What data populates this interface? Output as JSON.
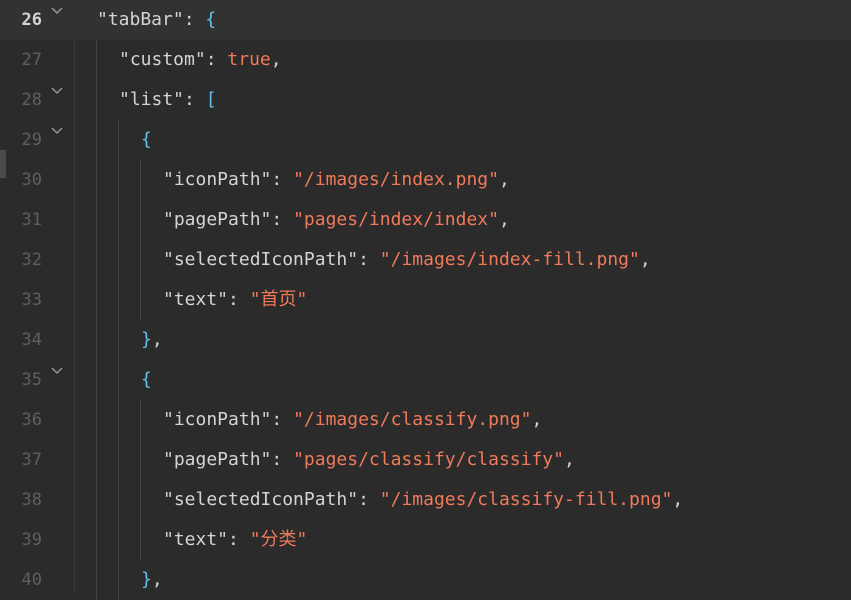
{
  "lines": [
    {
      "num": "26",
      "fold": true,
      "current": true,
      "indent": 1,
      "parts": [
        [
          "k",
          "\"tabBar\""
        ],
        [
          "p",
          ": "
        ],
        [
          "br",
          "{"
        ]
      ]
    },
    {
      "num": "27",
      "fold": false,
      "current": false,
      "indent": 2,
      "parts": [
        [
          "k",
          "\"custom\""
        ],
        [
          "p",
          ": "
        ],
        [
          "b",
          "true"
        ],
        [
          "p",
          ","
        ]
      ]
    },
    {
      "num": "28",
      "fold": true,
      "current": false,
      "indent": 2,
      "parts": [
        [
          "k",
          "\"list\""
        ],
        [
          "p",
          ": "
        ],
        [
          "br",
          "["
        ]
      ]
    },
    {
      "num": "29",
      "fold": true,
      "current": false,
      "indent": 3,
      "parts": [
        [
          "br",
          "{"
        ]
      ]
    },
    {
      "num": "30",
      "fold": false,
      "current": false,
      "indent": 4,
      "parts": [
        [
          "k",
          "\"iconPath\""
        ],
        [
          "p",
          ": "
        ],
        [
          "s",
          "\"/images/index.png\""
        ],
        [
          "p",
          ","
        ]
      ]
    },
    {
      "num": "31",
      "fold": false,
      "current": false,
      "indent": 4,
      "parts": [
        [
          "k",
          "\"pagePath\""
        ],
        [
          "p",
          ": "
        ],
        [
          "s",
          "\"pages/index/index\""
        ],
        [
          "p",
          ","
        ]
      ]
    },
    {
      "num": "32",
      "fold": false,
      "current": false,
      "indent": 4,
      "parts": [
        [
          "k",
          "\"selectedIconPath\""
        ],
        [
          "p",
          ": "
        ],
        [
          "s",
          "\"/images/index-fill.png\""
        ],
        [
          "p",
          ","
        ]
      ]
    },
    {
      "num": "33",
      "fold": false,
      "current": false,
      "indent": 4,
      "parts": [
        [
          "k",
          "\"text\""
        ],
        [
          "p",
          ": "
        ],
        [
          "s",
          "\"首页\""
        ]
      ]
    },
    {
      "num": "34",
      "fold": false,
      "current": false,
      "indent": 3,
      "parts": [
        [
          "br",
          "}"
        ],
        [
          "p",
          ","
        ]
      ]
    },
    {
      "num": "35",
      "fold": true,
      "current": false,
      "indent": 3,
      "parts": [
        [
          "br",
          "{"
        ]
      ]
    },
    {
      "num": "36",
      "fold": false,
      "current": false,
      "indent": 4,
      "parts": [
        [
          "k",
          "\"iconPath\""
        ],
        [
          "p",
          ": "
        ],
        [
          "s",
          "\"/images/classify.png\""
        ],
        [
          "p",
          ","
        ]
      ]
    },
    {
      "num": "37",
      "fold": false,
      "current": false,
      "indent": 4,
      "parts": [
        [
          "k",
          "\"pagePath\""
        ],
        [
          "p",
          ": "
        ],
        [
          "s",
          "\"pages/classify/classify\""
        ],
        [
          "p",
          ","
        ]
      ]
    },
    {
      "num": "38",
      "fold": false,
      "current": false,
      "indent": 4,
      "parts": [
        [
          "k",
          "\"selectedIconPath\""
        ],
        [
          "p",
          ": "
        ],
        [
          "s",
          "\"/images/classify-fill.png\""
        ],
        [
          "p",
          ","
        ]
      ]
    },
    {
      "num": "39",
      "fold": false,
      "current": false,
      "indent": 4,
      "parts": [
        [
          "k",
          "\"text\""
        ],
        [
          "p",
          ": "
        ],
        [
          "s",
          "\"分类\""
        ]
      ]
    },
    {
      "num": "40",
      "fold": false,
      "current": false,
      "indent": 3,
      "parts": [
        [
          "br",
          "}"
        ],
        [
          "p",
          ","
        ]
      ]
    }
  ],
  "colors": {
    "background": "#2b2b2b",
    "key": "#d4d4d4",
    "string": "#f07a5a",
    "bracket": "#62c0f0",
    "line_number": "#5f5f5f"
  }
}
